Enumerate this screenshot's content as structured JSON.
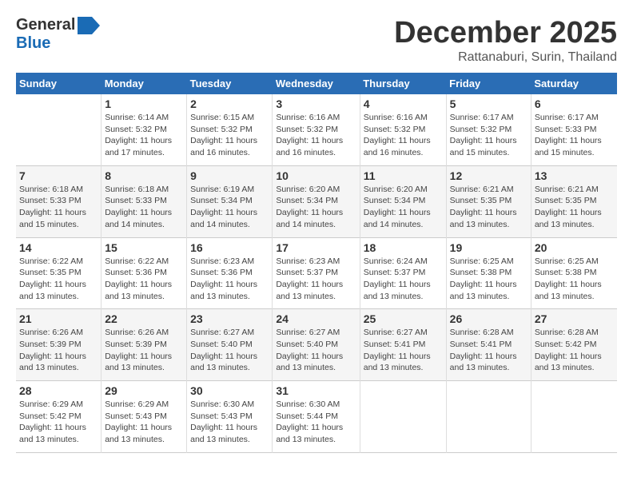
{
  "header": {
    "logo_general": "General",
    "logo_blue": "Blue",
    "month": "December 2025",
    "location": "Rattanaburi, Surin, Thailand"
  },
  "weekdays": [
    "Sunday",
    "Monday",
    "Tuesday",
    "Wednesday",
    "Thursday",
    "Friday",
    "Saturday"
  ],
  "weeks": [
    [
      {
        "day": "",
        "info": ""
      },
      {
        "day": "1",
        "info": "Sunrise: 6:14 AM\nSunset: 5:32 PM\nDaylight: 11 hours and 17 minutes."
      },
      {
        "day": "2",
        "info": "Sunrise: 6:15 AM\nSunset: 5:32 PM\nDaylight: 11 hours and 16 minutes."
      },
      {
        "day": "3",
        "info": "Sunrise: 6:16 AM\nSunset: 5:32 PM\nDaylight: 11 hours and 16 minutes."
      },
      {
        "day": "4",
        "info": "Sunrise: 6:16 AM\nSunset: 5:32 PM\nDaylight: 11 hours and 16 minutes."
      },
      {
        "day": "5",
        "info": "Sunrise: 6:17 AM\nSunset: 5:32 PM\nDaylight: 11 hours and 15 minutes."
      },
      {
        "day": "6",
        "info": "Sunrise: 6:17 AM\nSunset: 5:33 PM\nDaylight: 11 hours and 15 minutes."
      }
    ],
    [
      {
        "day": "7",
        "info": "Sunrise: 6:18 AM\nSunset: 5:33 PM\nDaylight: 11 hours and 15 minutes."
      },
      {
        "day": "8",
        "info": "Sunrise: 6:18 AM\nSunset: 5:33 PM\nDaylight: 11 hours and 14 minutes."
      },
      {
        "day": "9",
        "info": "Sunrise: 6:19 AM\nSunset: 5:34 PM\nDaylight: 11 hours and 14 minutes."
      },
      {
        "day": "10",
        "info": "Sunrise: 6:20 AM\nSunset: 5:34 PM\nDaylight: 11 hours and 14 minutes."
      },
      {
        "day": "11",
        "info": "Sunrise: 6:20 AM\nSunset: 5:34 PM\nDaylight: 11 hours and 14 minutes."
      },
      {
        "day": "12",
        "info": "Sunrise: 6:21 AM\nSunset: 5:35 PM\nDaylight: 11 hours and 13 minutes."
      },
      {
        "day": "13",
        "info": "Sunrise: 6:21 AM\nSunset: 5:35 PM\nDaylight: 11 hours and 13 minutes."
      }
    ],
    [
      {
        "day": "14",
        "info": "Sunrise: 6:22 AM\nSunset: 5:35 PM\nDaylight: 11 hours and 13 minutes."
      },
      {
        "day": "15",
        "info": "Sunrise: 6:22 AM\nSunset: 5:36 PM\nDaylight: 11 hours and 13 minutes."
      },
      {
        "day": "16",
        "info": "Sunrise: 6:23 AM\nSunset: 5:36 PM\nDaylight: 11 hours and 13 minutes."
      },
      {
        "day": "17",
        "info": "Sunrise: 6:23 AM\nSunset: 5:37 PM\nDaylight: 11 hours and 13 minutes."
      },
      {
        "day": "18",
        "info": "Sunrise: 6:24 AM\nSunset: 5:37 PM\nDaylight: 11 hours and 13 minutes."
      },
      {
        "day": "19",
        "info": "Sunrise: 6:25 AM\nSunset: 5:38 PM\nDaylight: 11 hours and 13 minutes."
      },
      {
        "day": "20",
        "info": "Sunrise: 6:25 AM\nSunset: 5:38 PM\nDaylight: 11 hours and 13 minutes."
      }
    ],
    [
      {
        "day": "21",
        "info": "Sunrise: 6:26 AM\nSunset: 5:39 PM\nDaylight: 11 hours and 13 minutes."
      },
      {
        "day": "22",
        "info": "Sunrise: 6:26 AM\nSunset: 5:39 PM\nDaylight: 11 hours and 13 minutes."
      },
      {
        "day": "23",
        "info": "Sunrise: 6:27 AM\nSunset: 5:40 PM\nDaylight: 11 hours and 13 minutes."
      },
      {
        "day": "24",
        "info": "Sunrise: 6:27 AM\nSunset: 5:40 PM\nDaylight: 11 hours and 13 minutes."
      },
      {
        "day": "25",
        "info": "Sunrise: 6:27 AM\nSunset: 5:41 PM\nDaylight: 11 hours and 13 minutes."
      },
      {
        "day": "26",
        "info": "Sunrise: 6:28 AM\nSunset: 5:41 PM\nDaylight: 11 hours and 13 minutes."
      },
      {
        "day": "27",
        "info": "Sunrise: 6:28 AM\nSunset: 5:42 PM\nDaylight: 11 hours and 13 minutes."
      }
    ],
    [
      {
        "day": "28",
        "info": "Sunrise: 6:29 AM\nSunset: 5:42 PM\nDaylight: 11 hours and 13 minutes."
      },
      {
        "day": "29",
        "info": "Sunrise: 6:29 AM\nSunset: 5:43 PM\nDaylight: 11 hours and 13 minutes."
      },
      {
        "day": "30",
        "info": "Sunrise: 6:30 AM\nSunset: 5:43 PM\nDaylight: 11 hours and 13 minutes."
      },
      {
        "day": "31",
        "info": "Sunrise: 6:30 AM\nSunset: 5:44 PM\nDaylight: 11 hours and 13 minutes."
      },
      {
        "day": "",
        "info": ""
      },
      {
        "day": "",
        "info": ""
      },
      {
        "day": "",
        "info": ""
      }
    ]
  ]
}
